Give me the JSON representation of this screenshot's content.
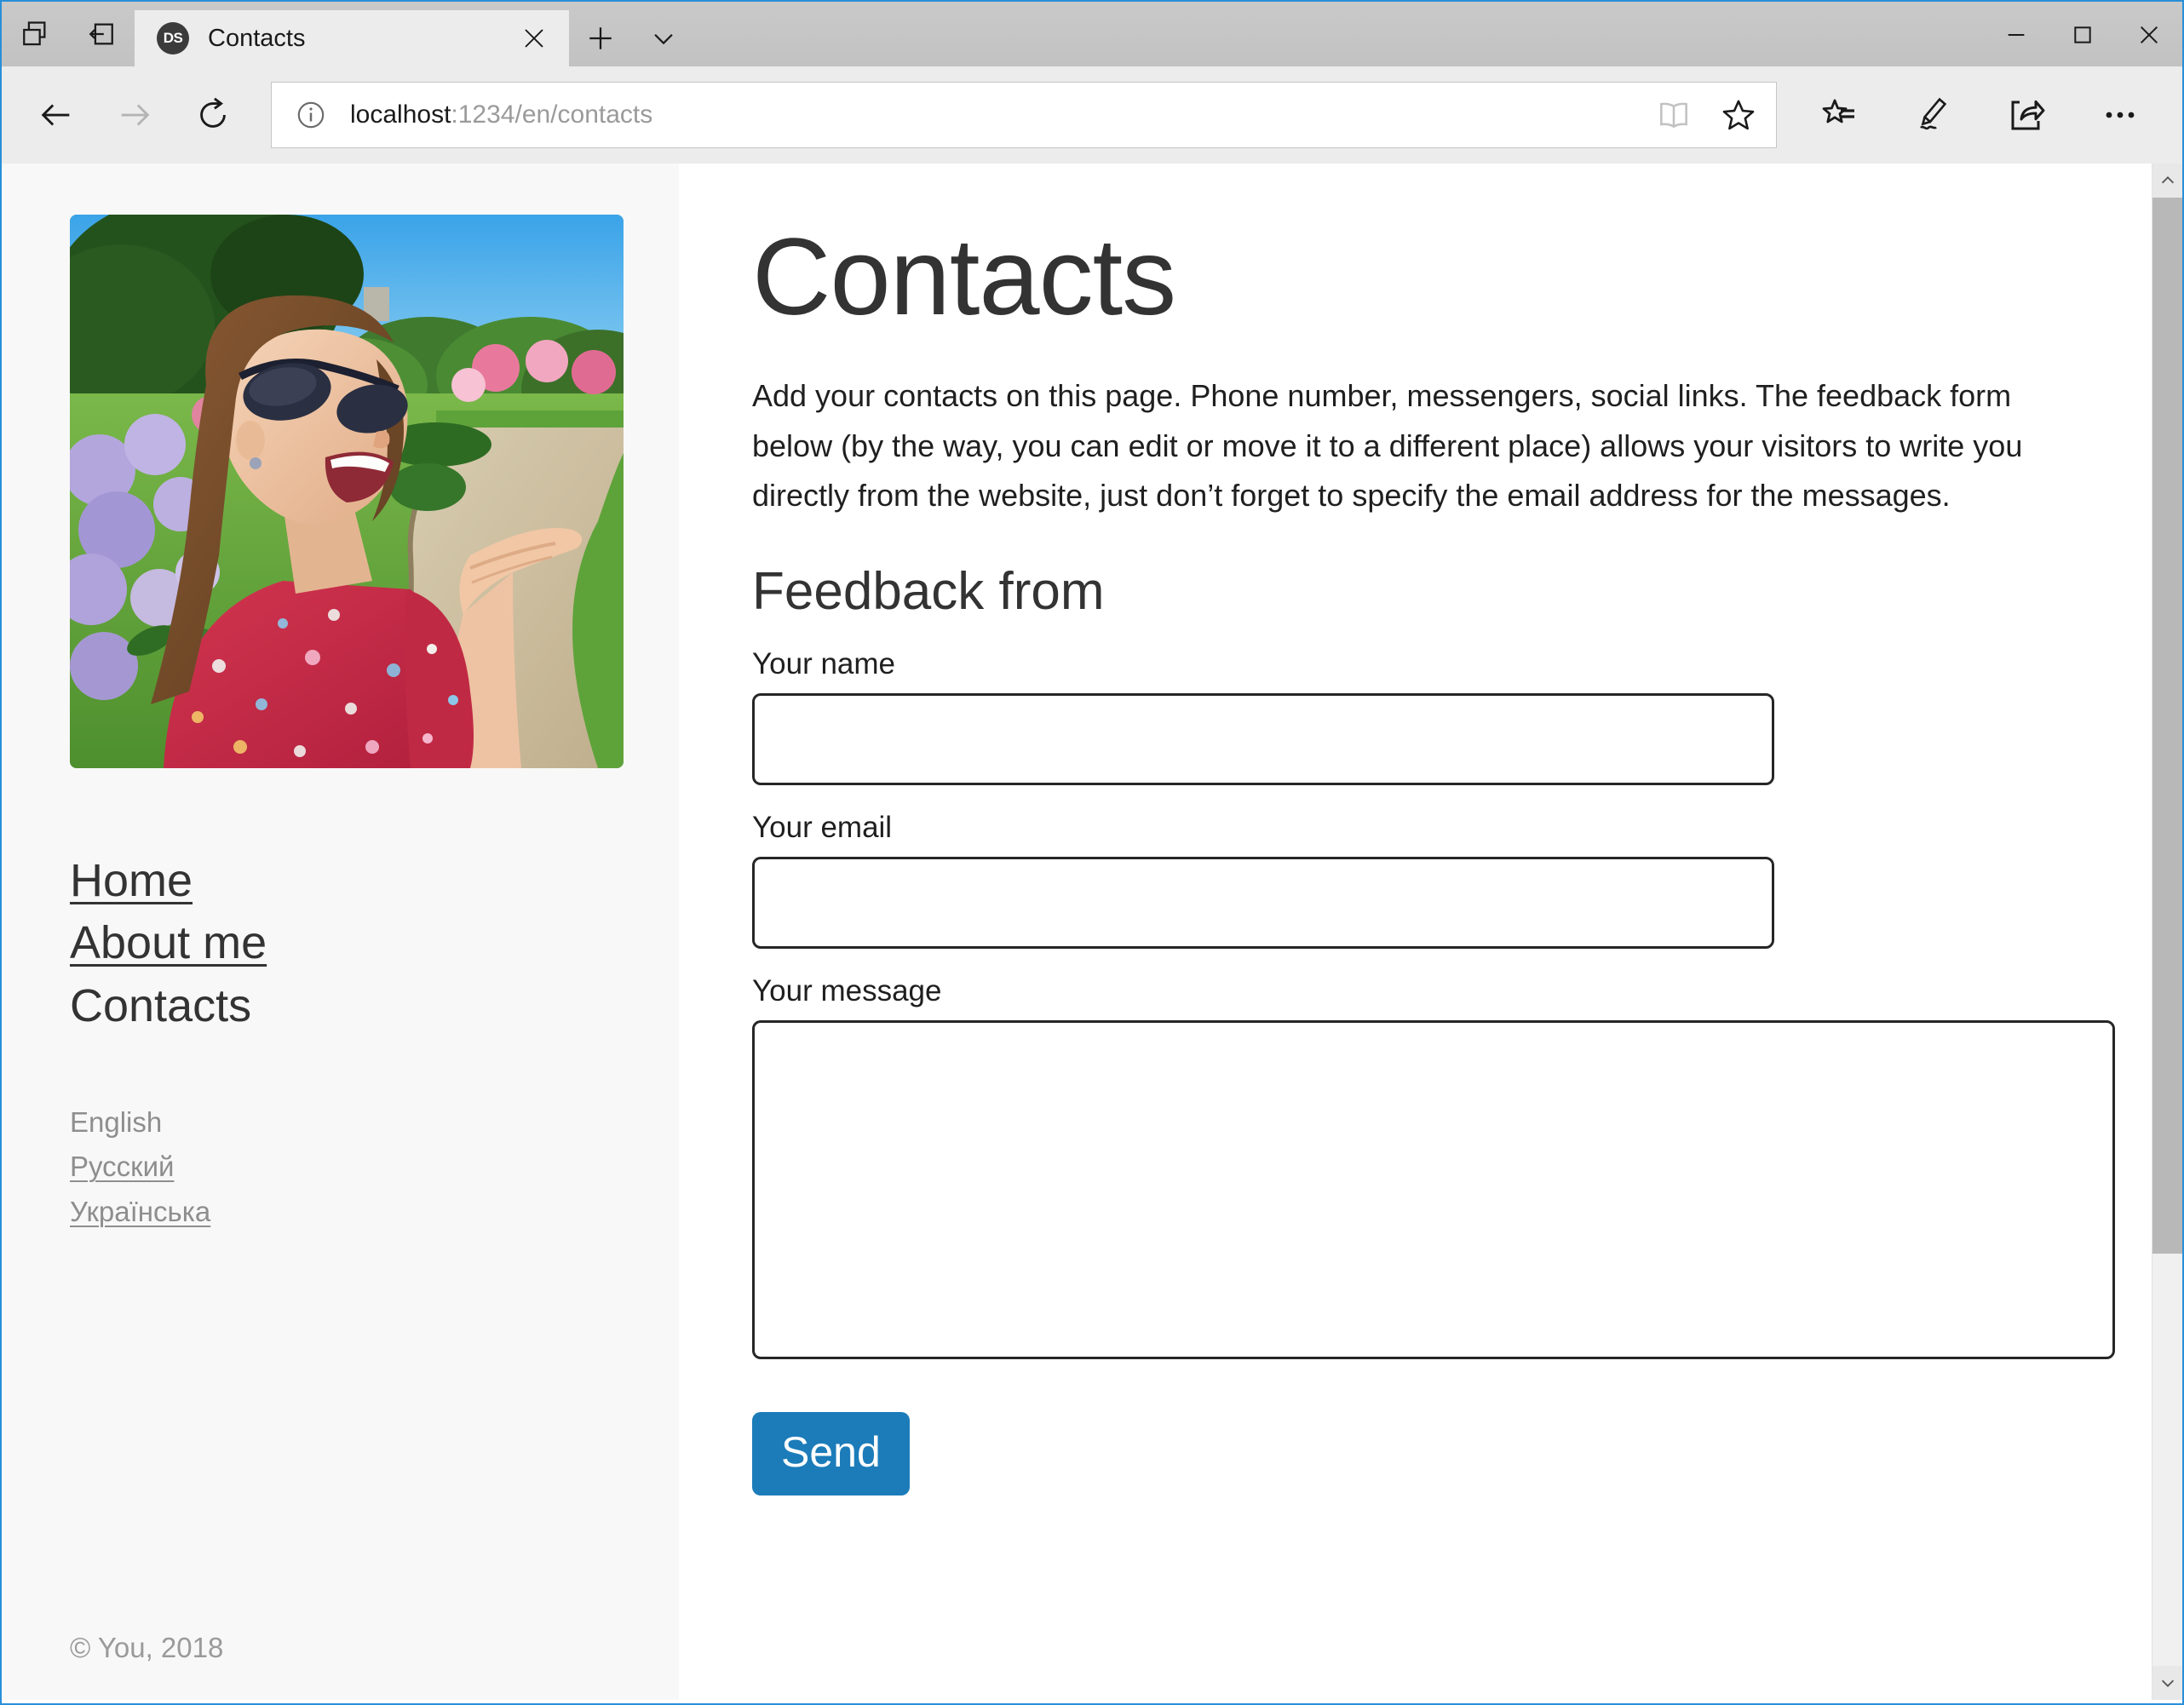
{
  "browser": {
    "window_controls": {
      "minimize": "minimize-icon",
      "maximize": "maximize-icon",
      "close": "close-icon"
    },
    "tab_strip_buttons": {
      "show_tabs_aside": "show-tabs-aside-icon",
      "tabs_you_set_aside": "tabs-set-aside-icon",
      "new_tab": "+",
      "tab_menu": "chevron-down-icon"
    },
    "tab": {
      "favicon_label": "DS",
      "title": "Contacts",
      "close": "close-icon"
    },
    "nav": {
      "back": "back-arrow-icon",
      "forward": "forward-arrow-icon",
      "refresh": "refresh-icon"
    },
    "address": {
      "info_icon": "info-icon",
      "url_host": "localhost",
      "url_path": ":1234/en/contacts",
      "full_url": "localhost:1234/en/contacts",
      "reading_view": "book-icon",
      "add_favorite": "star-icon"
    },
    "toolbar": {
      "hub": "hub-favorites-icon",
      "web_note": "pen-icon",
      "share": "share-icon",
      "settings": "ellipsis-icon"
    },
    "scrollbar": {
      "up_arrow": "chevron-up-icon",
      "down_arrow": "chevron-down-icon"
    }
  },
  "sidebar": {
    "photo_alt": "woman-blowing-kiss-in-garden-photo",
    "nav_items": [
      {
        "label": "Home",
        "state": "link"
      },
      {
        "label": "About me",
        "state": "link"
      },
      {
        "label": "Contacts",
        "state": "current"
      }
    ],
    "languages": [
      {
        "label": "English",
        "state": "current"
      },
      {
        "label": "Русский",
        "state": "link"
      },
      {
        "label": "Українська",
        "state": "link"
      }
    ],
    "footer": "© You, 2018"
  },
  "main": {
    "title": "Contacts",
    "intro": "Add your contacts on this page. Phone number, messengers, social links. The feedback form below (by the way, you can edit or move it to a different place) allows your visitors to write you directly from the website, just don’t forget to specify the email address for the messages.",
    "form": {
      "heading": "Feedback from",
      "fields": [
        {
          "label": "Your name",
          "value": "",
          "placeholder": ""
        },
        {
          "label": "Your email",
          "value": "",
          "placeholder": ""
        },
        {
          "label": "Your message",
          "value": "",
          "placeholder": ""
        }
      ],
      "submit_label": "Send"
    }
  },
  "colors": {
    "accent_blue": "#1c7cba",
    "window_border": "#2a8fd8",
    "sidebar_bg": "#f8f8f8",
    "heading": "#333333",
    "muted_text": "#8e8e8e"
  }
}
